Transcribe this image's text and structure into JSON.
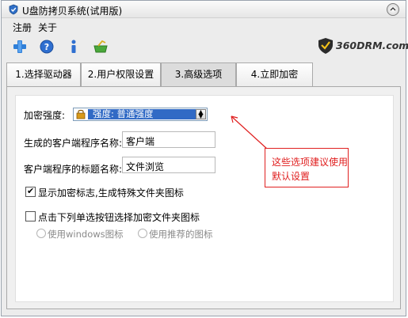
{
  "window": {
    "title": "U盘防拷贝系统(试用版)"
  },
  "menu": {
    "register": "注册",
    "about": "关于"
  },
  "toolbar": {
    "icons": [
      "plus-icon",
      "help-icon",
      "info-icon",
      "buy-icon"
    ]
  },
  "brand": {
    "text": "360DRM.com"
  },
  "tabs": [
    {
      "label": "1.选择驱动器"
    },
    {
      "label": "2.用户权限设置"
    },
    {
      "label": "3.高级选项",
      "active": true
    },
    {
      "label": "4.立即加密"
    }
  ],
  "form": {
    "strength_label": "加密强度:",
    "strength_value": "强度: 普通强度",
    "client_name_label": "生成的客户端程序名称:",
    "client_name_value": "客户端",
    "client_title_label": "客户端程序的标题名称:",
    "client_title_value": "文件浏览",
    "show_mark_label": "显示加密标志,生成特殊文件夹图标",
    "show_mark_checked": true,
    "pick_icon_label": "点击下列单选按钮选择加密文件夹图标",
    "pick_icon_checked": false,
    "radio_windows": "使用windows图标",
    "radio_recommended": "使用推荐的图标"
  },
  "callout": {
    "line1": "这些选项建议使用",
    "line2": "默认设置"
  },
  "colors": {
    "selection": "#316ac5",
    "callout_red": "#e02020",
    "panel_bg": "#f0f0f0"
  }
}
